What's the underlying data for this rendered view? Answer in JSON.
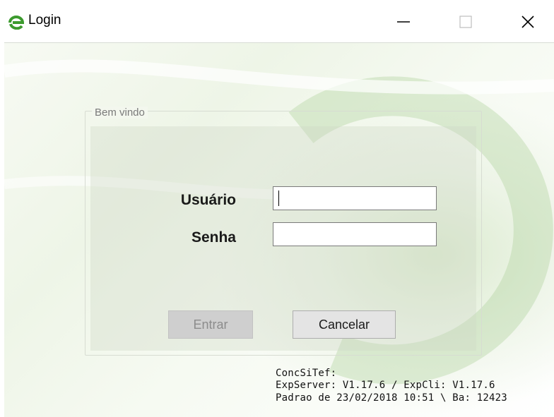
{
  "window": {
    "title": "Login",
    "controls": [
      "minimize",
      "maximize",
      "close"
    ]
  },
  "group": {
    "legend": "Bem vindo"
  },
  "form": {
    "user_label": "Usuário",
    "user_value": "",
    "password_label": "Senha",
    "password_value": ""
  },
  "buttons": {
    "enter_label": "Entrar",
    "enter_enabled": false,
    "cancel_label": "Cancelar"
  },
  "info": {
    "line1": "ConcSiTef:",
    "line2": "ExpServer: V1.17.6 / ExpCli: V1.17.6",
    "line3": "Padrao de 23/02/2018 10:51 \\ Ba: 12423"
  },
  "colors": {
    "accent_green": "#3c9a2e",
    "background_tint": "#eef5e7"
  }
}
